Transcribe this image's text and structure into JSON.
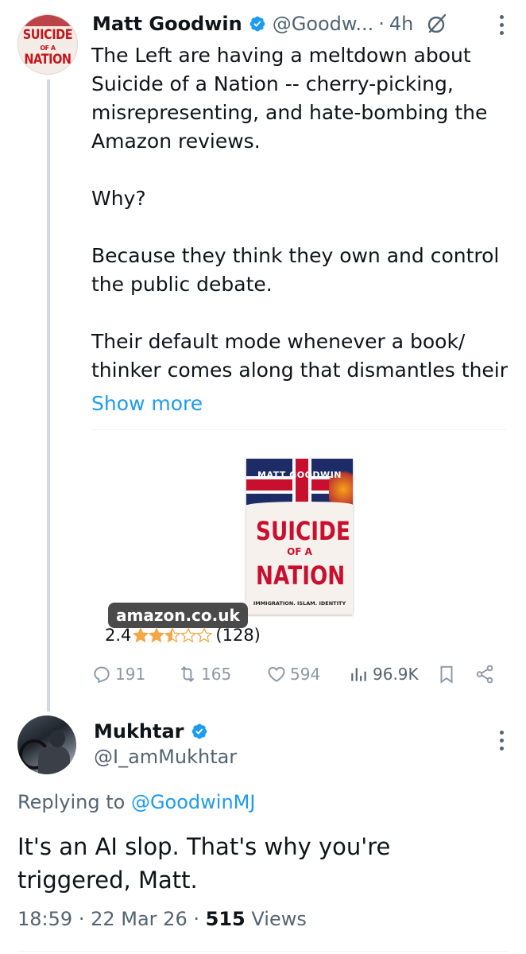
{
  "tweet": {
    "avatar_text": [
      "SUICIDE",
      "OF A",
      "NATION"
    ],
    "author_name": "Matt Goodwin",
    "author_handle": "@Goodw...",
    "separator": "·",
    "time": "4h",
    "paragraphs": [
      "The Left are having a meltdown about Suicide of a Nation -- cherry-picking, misrepresenting, and hate-bombing the Amazon reviews.",
      "Why?",
      "Because they think they own and control the public debate.",
      "Their default mode whenever a book/ thinker comes along that dismantles their"
    ],
    "show_more": "Show more",
    "card": {
      "book_author": "MATT GOODWIN",
      "book_title_1": "SUICIDE",
      "book_title_2": "OF A",
      "book_title_3": "NATION",
      "book_subtitle": "IMMIGRATION. ISLAM. IDENTITY",
      "source": "amazon.co.uk",
      "rating": "2.4",
      "rating_stars": 2.5,
      "rating_count": "(128)"
    },
    "actions": {
      "replies": "191",
      "reposts": "165",
      "likes": "594",
      "views": "96.9K"
    }
  },
  "reply": {
    "author_name": "Mukhtar",
    "author_handle": "@I_amMukhtar",
    "replying_prefix": "Replying to",
    "replying_to": "@GoodwinMJ",
    "body": "It's an AI slop. That's why you're triggered, Matt.",
    "time": "18:59",
    "date": "22 Mar 26",
    "views_count": "515",
    "views_label": "Views",
    "separator": "·"
  },
  "colors": {
    "accent": "#1d9bf0",
    "secondary_text": "#536471",
    "star": "#f3a847"
  }
}
